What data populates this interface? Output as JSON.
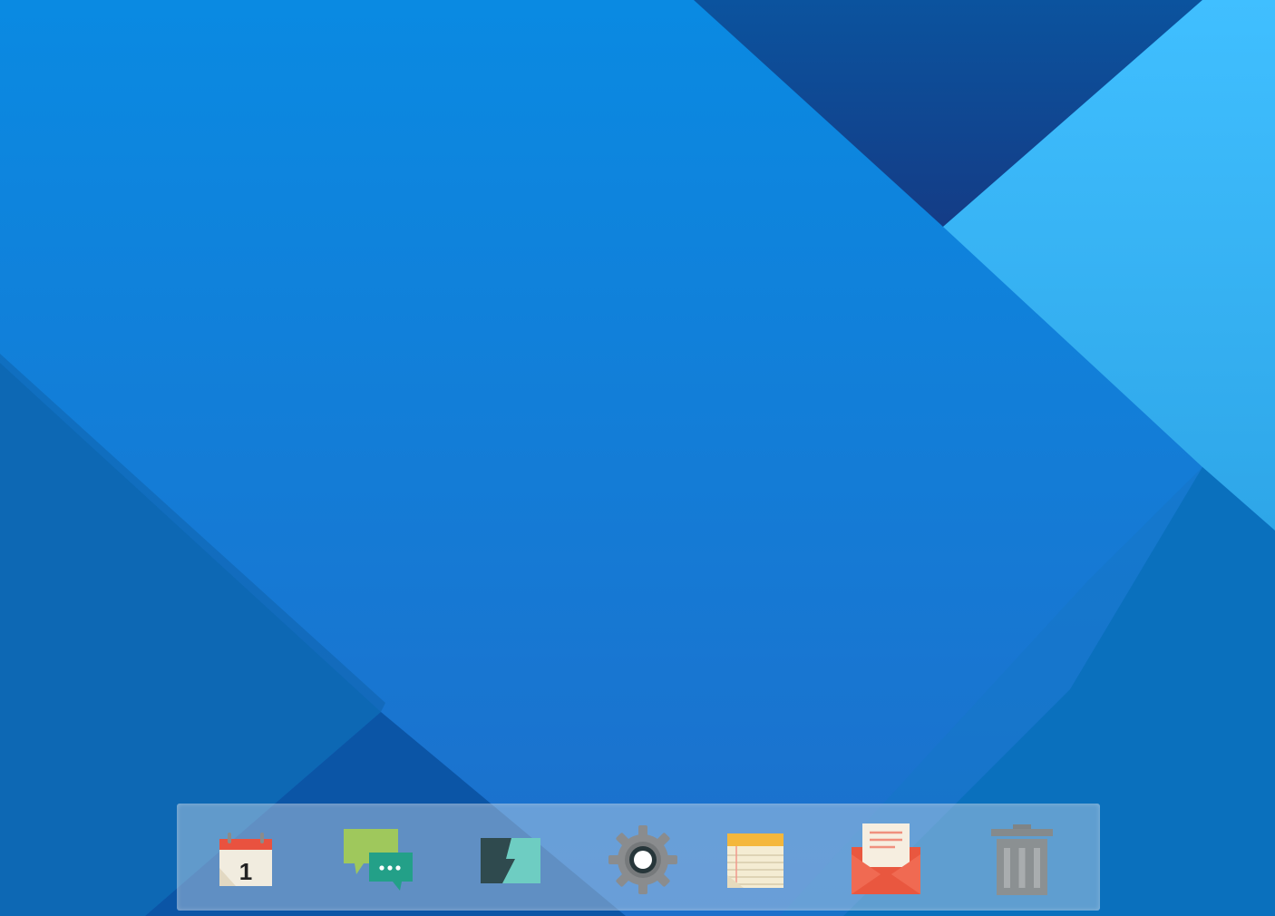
{
  "desktop": {
    "wallpaper": {
      "colors": {
        "main": "#1878d8",
        "dark": "#0f4f9a",
        "light": "#3bb4ef",
        "mid": "#0b6ab7"
      }
    }
  },
  "dock": {
    "items": [
      {
        "name": "calendar",
        "icon": "calendar-icon",
        "day": "1"
      },
      {
        "name": "messages",
        "icon": "chat-bubbles-icon"
      },
      {
        "name": "terminal",
        "icon": "lightning-app-icon"
      },
      {
        "name": "settings",
        "icon": "gear-icon"
      },
      {
        "name": "notes",
        "icon": "notepad-icon"
      },
      {
        "name": "mail",
        "icon": "envelope-icon"
      },
      {
        "name": "trash",
        "icon": "trash-icon"
      }
    ]
  }
}
